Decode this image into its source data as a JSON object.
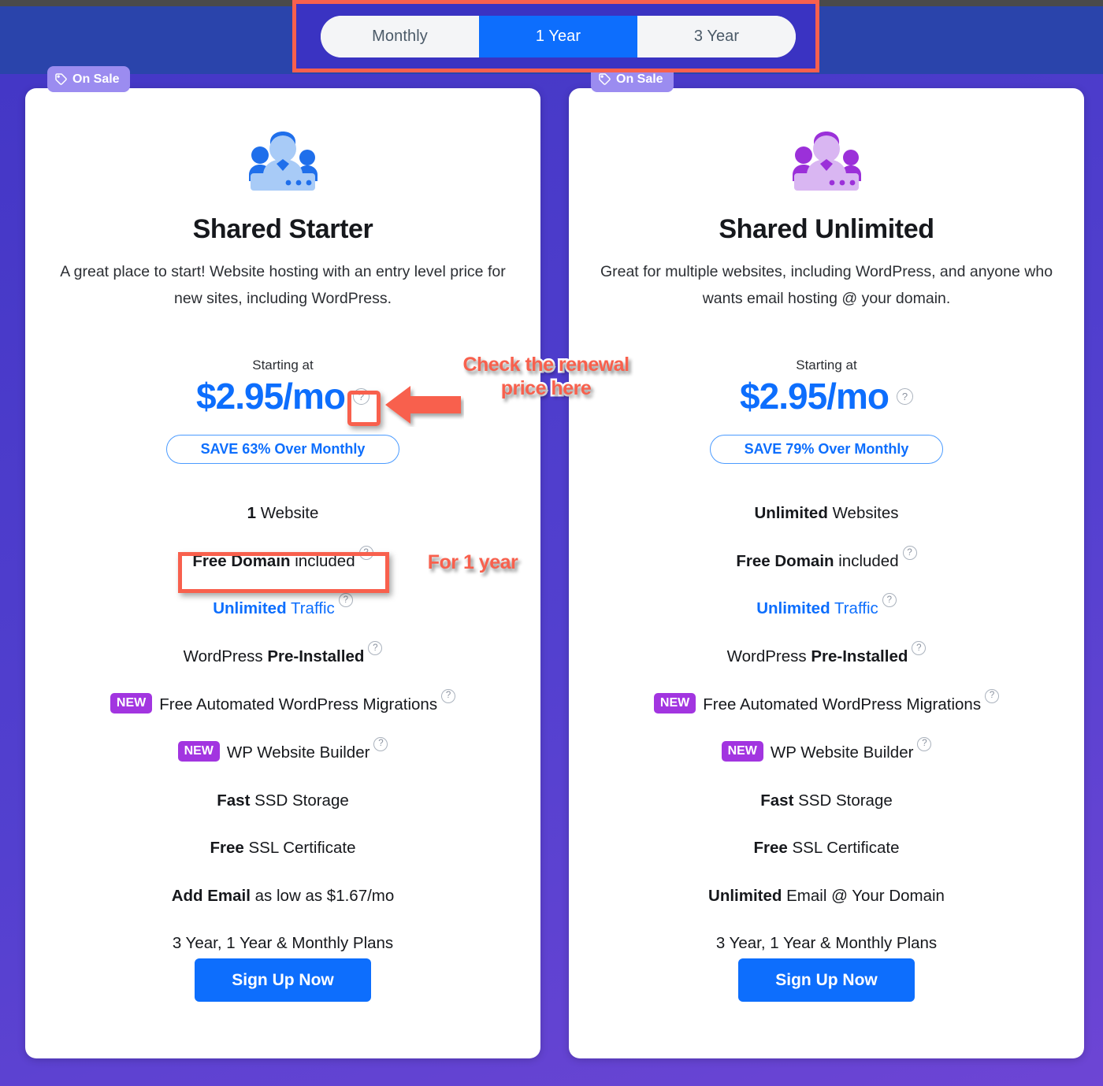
{
  "billing_toggle": {
    "name": "billing-period-toggle",
    "options": [
      {
        "label": "Monthly",
        "active": false
      },
      {
        "label": "1 Year",
        "active": true
      },
      {
        "label": "3 Year",
        "active": false
      }
    ],
    "selected": "1 Year",
    "active_color": "#0d6efd"
  },
  "colors": {
    "background": "#4a3fc4",
    "accent_blue": "#0d6efd",
    "badge_purple": "#9b8cf0",
    "new_purple": "#a235e0",
    "annotation_red": "#f8604d"
  },
  "plans": [
    {
      "id": "shared-starter",
      "sale_badge": "On Sale",
      "icon": "people-group-icon",
      "icon_color": "blue",
      "name": "Shared Starter",
      "description": "A great place to start! Website hosting with an entry level price for new sites, including WordPress.",
      "starting_at_label": "Starting at",
      "price": "$2.95/mo",
      "price_tooltip": "?",
      "save_label": "SAVE 63% Over Monthly",
      "features": [
        {
          "bold": "1",
          "text": " Website",
          "tooltip": false
        },
        {
          "bold": "Free Domain",
          "text": " included",
          "tooltip": true
        },
        {
          "bold": "Unlimited",
          "text": " Traffic",
          "tooltip": true,
          "blue": true
        },
        {
          "bold_after": "Pre-Installed",
          "text": "WordPress ",
          "tooltip": true
        },
        {
          "badge": "NEW",
          "text": "Free Automated WordPress Migrations",
          "tooltip": true
        },
        {
          "badge": "NEW",
          "text": "WP Website Builder",
          "tooltip": true
        },
        {
          "bold": "Fast",
          "text": " SSD Storage",
          "tooltip": false
        },
        {
          "bold": "Free",
          "text": " SSL Certificate",
          "tooltip": false
        },
        {
          "bold": "Add Email",
          "text": " as low as $1.67/mo",
          "tooltip": false
        },
        {
          "text": "3 Year, 1 Year & Monthly Plans",
          "tooltip": false
        }
      ],
      "cta": "Sign Up Now"
    },
    {
      "id": "shared-unlimited",
      "sale_badge": "On Sale",
      "icon": "people-group-icon",
      "icon_color": "purple",
      "name": "Shared Unlimited",
      "description": "Great for multiple websites, including WordPress, and anyone who wants email hosting @ your domain.",
      "starting_at_label": "Starting at",
      "price": "$2.95/mo",
      "price_tooltip": "?",
      "save_label": "SAVE 79% Over Monthly",
      "features": [
        {
          "bold": "Unlimited",
          "text": " Websites",
          "tooltip": false
        },
        {
          "bold": "Free Domain",
          "text": " included",
          "tooltip": true
        },
        {
          "bold": "Unlimited",
          "text": " Traffic",
          "tooltip": true,
          "blue": true
        },
        {
          "bold_after": "Pre-Installed",
          "text": "WordPress ",
          "tooltip": true
        },
        {
          "badge": "NEW",
          "text": "Free Automated WordPress Migrations",
          "tooltip": true
        },
        {
          "badge": "NEW",
          "text": "WP Website Builder",
          "tooltip": true
        },
        {
          "bold": "Fast",
          "text": " SSD Storage",
          "tooltip": false
        },
        {
          "bold": "Free",
          "text": " SSL Certificate",
          "tooltip": false
        },
        {
          "bold": "Unlimited",
          "text": " Email @ Your Domain",
          "tooltip": false
        },
        {
          "text": "3 Year, 1 Year & Monthly Plans",
          "tooltip": false
        }
      ],
      "cta": "Sign Up Now"
    }
  ],
  "annotations": {
    "renewal_note": "Check the renewal price here",
    "domain_note": "For 1 year"
  }
}
